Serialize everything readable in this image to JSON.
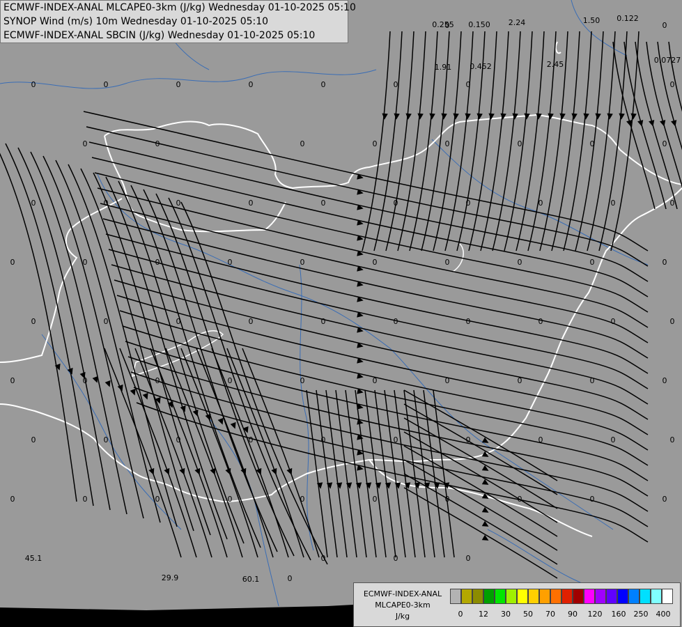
{
  "header": {
    "line1": "ECMWF-INDEX-ANAL MLCAPE0-3km (J/kg) Wednesday 01-10-2025 05:10",
    "line2": "SYNOP Wind (m/s) 10m Wednesday 01-10-2025 05:10",
    "line3": "ECMWF-INDEX-ANAL SBCIN (J/kg) Wednesday 01-10-2025 05:10"
  },
  "legend": {
    "title_line1": "ECMWF-INDEX-ANAL",
    "title_line2": "MLCAPE0-3km",
    "title_line3": "J/kg",
    "colors": [
      "#b3b3b3",
      "#b3a800",
      "#8c8c00",
      "#00a000",
      "#00e600",
      "#a0f000",
      "#ffff00",
      "#ffd000",
      "#ffa000",
      "#ff7000",
      "#e02000",
      "#a00000",
      "#ff00ff",
      "#a000ff",
      "#6000ff",
      "#0000ff",
      "#0080ff",
      "#00e0ff",
      "#80ffff",
      "#ffffff"
    ],
    "ticks": [
      "0",
      "12",
      "30",
      "50",
      "70",
      "90",
      "120",
      "160",
      "250",
      "400"
    ]
  },
  "value_labels": [
    {
      "v": "0"
    },
    {
      "v": "0.0008"
    },
    {
      "v": "0"
    },
    {
      "v": "0.255"
    },
    {
      "v": "0.150"
    },
    {
      "v": "2.24"
    },
    {
      "v": "0"
    },
    {
      "v": "1.50"
    },
    {
      "v": "0.122"
    },
    {
      "v": "0"
    },
    {
      "v": "0"
    },
    {
      "v": "0"
    },
    {
      "v": "0"
    },
    {
      "v": "0"
    },
    {
      "v": "0"
    },
    {
      "v": "0"
    },
    {
      "v": "0"
    },
    {
      "v": "1.91"
    },
    {
      "v": "0.452"
    },
    {
      "v": "0"
    },
    {
      "v": "2.45"
    },
    {
      "v": "0"
    },
    {
      "v": "0"
    },
    {
      "v": "0.0727"
    },
    {
      "v": "0"
    },
    {
      "v": "0"
    },
    {
      "v": "0"
    },
    {
      "v": "0"
    },
    {
      "v": "0"
    },
    {
      "v": "0"
    },
    {
      "v": "0"
    },
    {
      "v": "0"
    },
    {
      "v": "0"
    },
    {
      "v": "0"
    },
    {
      "v": "0"
    },
    {
      "v": "0"
    },
    {
      "v": "0"
    },
    {
      "v": "0"
    },
    {
      "v": "0"
    },
    {
      "v": "0"
    },
    {
      "v": "0"
    },
    {
      "v": "0"
    },
    {
      "v": "0"
    },
    {
      "v": "0"
    },
    {
      "v": "0"
    },
    {
      "v": "0"
    },
    {
      "v": "0"
    },
    {
      "v": "0"
    },
    {
      "v": "0"
    },
    {
      "v": "0"
    },
    {
      "v": "0"
    },
    {
      "v": "0"
    },
    {
      "v": "0"
    },
    {
      "v": "0"
    },
    {
      "v": "0"
    },
    {
      "v": "0"
    },
    {
      "v": "0"
    },
    {
      "v": "0"
    },
    {
      "v": "0"
    },
    {
      "v": "0"
    },
    {
      "v": "0"
    },
    {
      "v": "0"
    },
    {
      "v": "0"
    },
    {
      "v": "0"
    },
    {
      "v": "0"
    },
    {
      "v": "0"
    },
    {
      "v": "0"
    },
    {
      "v": "0"
    },
    {
      "v": "0"
    },
    {
      "v": "0"
    },
    {
      "v": "0"
    },
    {
      "v": "0"
    },
    {
      "v": "0"
    },
    {
      "v": "0"
    },
    {
      "v": "0"
    },
    {
      "v": "0"
    },
    {
      "v": "0"
    },
    {
      "v": "0"
    },
    {
      "v": "0"
    },
    {
      "v": "0"
    },
    {
      "v": "0"
    },
    {
      "v": "0"
    },
    {
      "v": "0"
    },
    {
      "v": "0"
    },
    {
      "v": "0"
    },
    {
      "v": "0"
    },
    {
      "v": "0"
    },
    {
      "v": "0"
    },
    {
      "v": "0"
    },
    {
      "v": "0"
    },
    {
      "v": "45.1"
    },
    {
      "v": "29.9"
    },
    {
      "v": "60.1"
    },
    {
      "v": "0"
    },
    {
      "v": "0"
    },
    {
      "v": "0"
    },
    {
      "v": "0"
    }
  ]
}
